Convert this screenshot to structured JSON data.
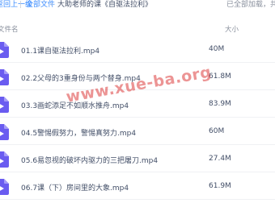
{
  "breadcrumb": {
    "back": "返回上一级",
    "separator": "|",
    "all": "全部文件",
    "sep2": "›",
    "current": "大助老师的课《自驱法拉利》",
    "status": "已全部加载，共"
  },
  "columns": {
    "name": "文件名",
    "size": "大小"
  },
  "files": [
    {
      "name": "01.1课自驱法拉利.mp4",
      "size": "40M",
      "icon": "video-file-icon"
    },
    {
      "name": "02.2父母的3重身份与两个替身.mp4",
      "size": "61.8M",
      "icon": "video-file-icon"
    },
    {
      "name": "03.3画蛇添足不如顺水推舟.mp4",
      "size": "83.9M",
      "icon": "video-file-icon"
    },
    {
      "name": "04.5警惕假努力，警惕真努力.mp4",
      "size": "60M",
      "icon": "video-file-icon"
    },
    {
      "name": "05.6易忽视的破坏内驱力的三把屠刀.mp4",
      "size": "27.4M",
      "icon": "video-file-icon"
    },
    {
      "name": "06.7课（下）房间里的大象.mp4",
      "size": "61.9M",
      "icon": "video-file-icon"
    }
  ],
  "watermark": "www.xue-ba.org",
  "colors": {
    "accent": "#3b8cff",
    "icon": "#6a5cf0",
    "watermark": "#dc3c3c"
  }
}
